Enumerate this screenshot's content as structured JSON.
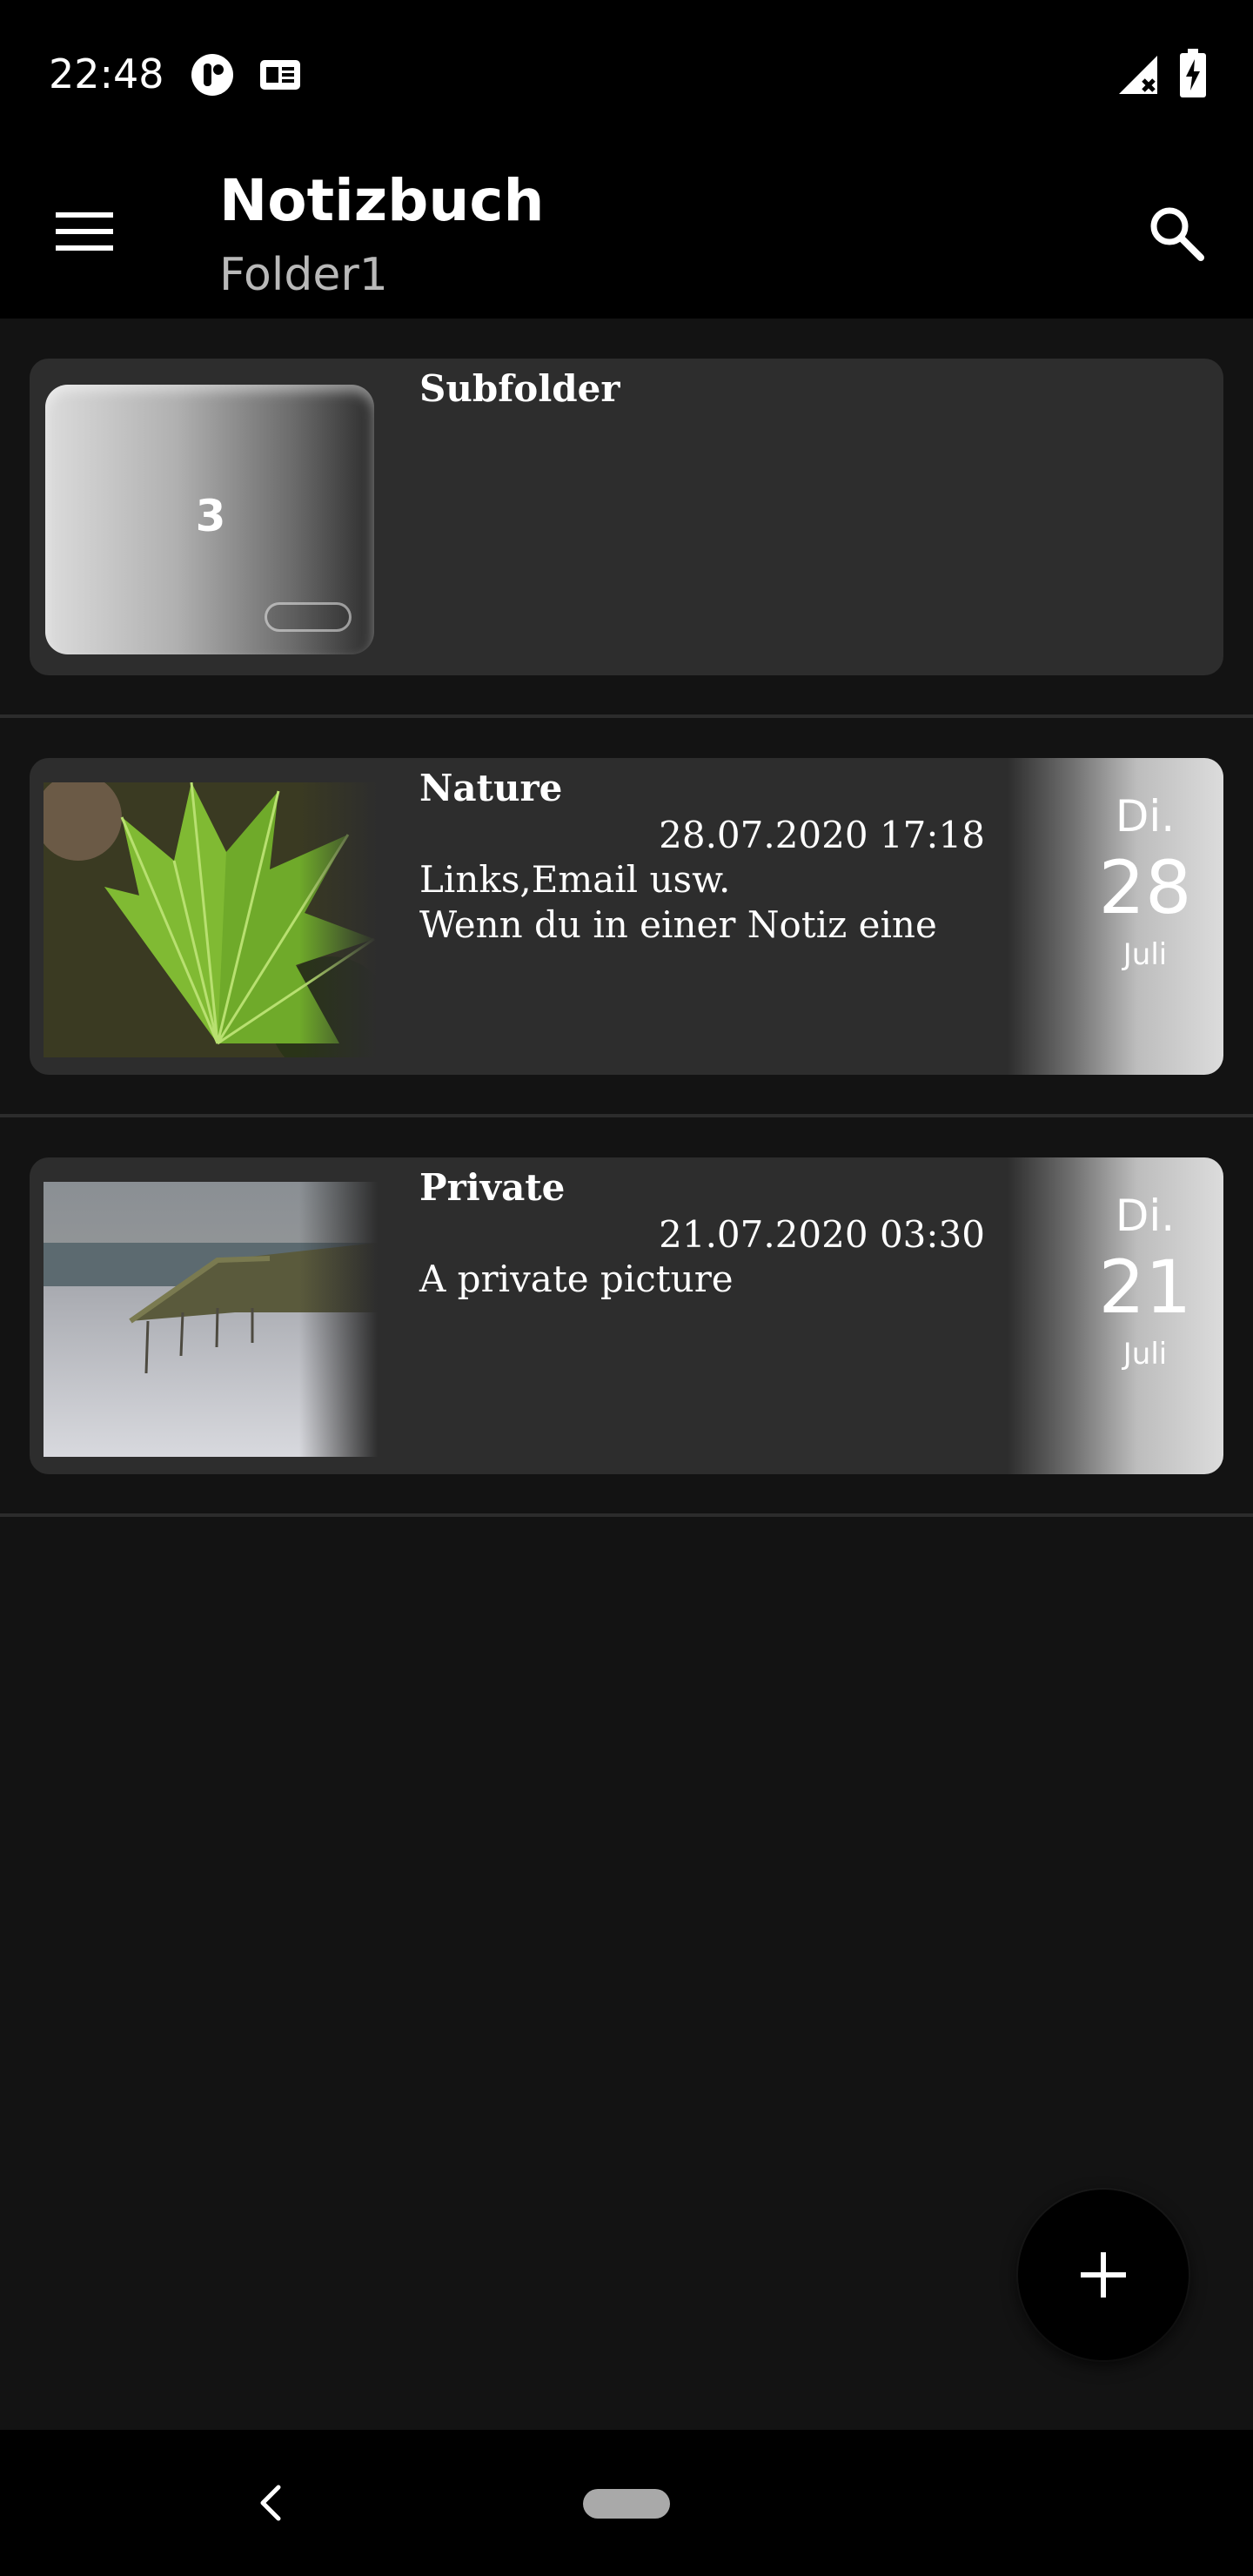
{
  "status_bar": {
    "time": "22:48",
    "icons": [
      "notification-app-icon",
      "news-icon",
      "signal-icon",
      "battery-charging-icon"
    ]
  },
  "app_bar": {
    "title": "Notizbuch",
    "subtitle": "Folder1",
    "icons": [
      "menu-icon",
      "search-icon"
    ]
  },
  "items": [
    {
      "type": "folder",
      "title": "Subfolder",
      "count": "3"
    },
    {
      "type": "note",
      "title": "Nature",
      "datetime": "28.07.2020 17:18",
      "text": "Links,Email usw.\nWenn du in einer Notiz eine",
      "badge": {
        "weekday": "Di.",
        "day": "28",
        "month": "Juli"
      },
      "thumbnail": "leaf-image"
    },
    {
      "type": "note",
      "title": "Private",
      "datetime": "21.07.2020 03:30",
      "text": "A private picture",
      "badge": {
        "weekday": "Di.",
        "day": "21",
        "month": "Juli"
      },
      "thumbnail": "beach-image"
    }
  ],
  "fab": {
    "icon": "plus-icon"
  },
  "nav_bar": {
    "icons": [
      "back-icon",
      "home-pill"
    ]
  },
  "colors": {
    "background": "#131313",
    "bar": "#000000",
    "card": "#2d2d2d",
    "subtitle": "#b9b9b9"
  }
}
